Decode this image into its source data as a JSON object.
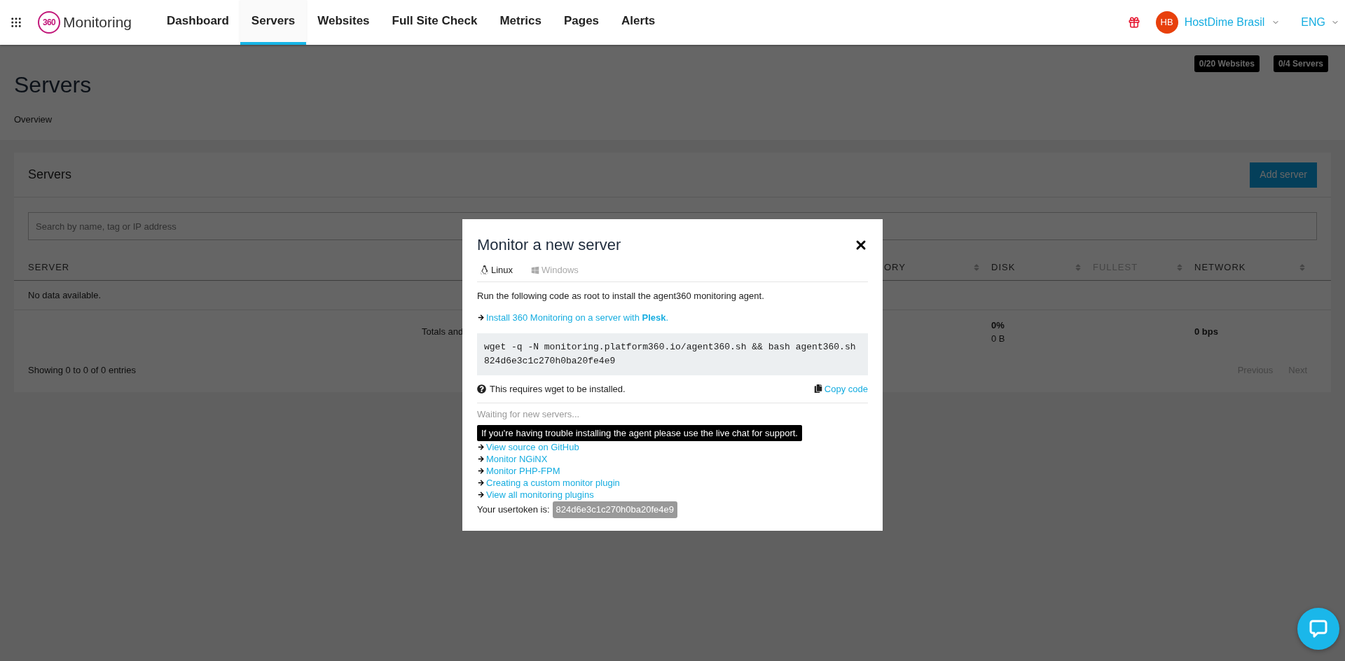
{
  "header": {
    "logo_mark": "360",
    "logo_name": "Monitoring",
    "nav": [
      {
        "label": "Dashboard",
        "selected": false
      },
      {
        "label": "Servers",
        "selected": true
      },
      {
        "label": "Websites",
        "selected": false
      },
      {
        "label": "Full Site Check",
        "selected": false
      },
      {
        "label": "Metrics",
        "selected": false
      },
      {
        "label": "Pages",
        "selected": false
      },
      {
        "label": "Alerts",
        "selected": false
      }
    ],
    "account": {
      "initials": "HB",
      "name": "HostDime Brasil"
    },
    "language": "ENG"
  },
  "page": {
    "badges": [
      "0/20 Websites",
      "0/4 Servers"
    ],
    "title": "Servers",
    "breadcrumb": "Overview"
  },
  "panel": {
    "title": "Servers",
    "add_button": "Add server",
    "search": {
      "placeholder": "Search by name, tag or IP address"
    },
    "columns": [
      {
        "label": "SERVER",
        "disabled": false
      },
      {
        "label": "ORY",
        "sortable": true,
        "disabled": false
      },
      {
        "label": "DISK",
        "sortable": true,
        "disabled": false
      },
      {
        "label": "FULLEST",
        "sortable": true,
        "disabled": true
      },
      {
        "label": "NETWORK",
        "sortable": true,
        "disabled": false
      }
    ],
    "empty_text": "No data available.",
    "totals": {
      "label": "Totals and",
      "disk_percent": "0%",
      "disk_size": "0 B",
      "network": "0 bps"
    },
    "footer": "Showing 0 to 0 of 0 entries",
    "pagination": [
      {
        "label": "Previous",
        "disabled": true
      },
      {
        "label": "Next",
        "disabled": true
      }
    ]
  },
  "modal": {
    "title": "Monitor a new server",
    "tabs": [
      {
        "label": "Linux",
        "kind": "linux",
        "selected": true
      },
      {
        "label": "Windows",
        "kind": "windows",
        "selected": false
      }
    ],
    "instruction": "Run the following code as root to install the agent360 monitoring agent.",
    "plesk_link": "Install 360 Monitoring on a server with **Plesk**.",
    "code_lines": [
      "wget -q -N monitoring.platform360.io/agent360.sh && bash agent360.sh",
      "824d6e3c1c270h0ba20fe4e9"
    ],
    "requirement": "This requires wget to be installed.",
    "copy_button": "Copy code",
    "waiting": "Waiting for new servers...",
    "support_notice": "If you're having trouble installing the agent please use the live chat for support.",
    "links": [
      "View source on GitHub",
      "Monitor NGiNX",
      "Monitor PHP-FPM",
      "Creating a custom monitor plugin",
      "View all monitoring plugins"
    ],
    "usertoken_label": "Your usertoken is:",
    "usertoken": "824d6e3c1c270h0ba20fe4e9"
  }
}
